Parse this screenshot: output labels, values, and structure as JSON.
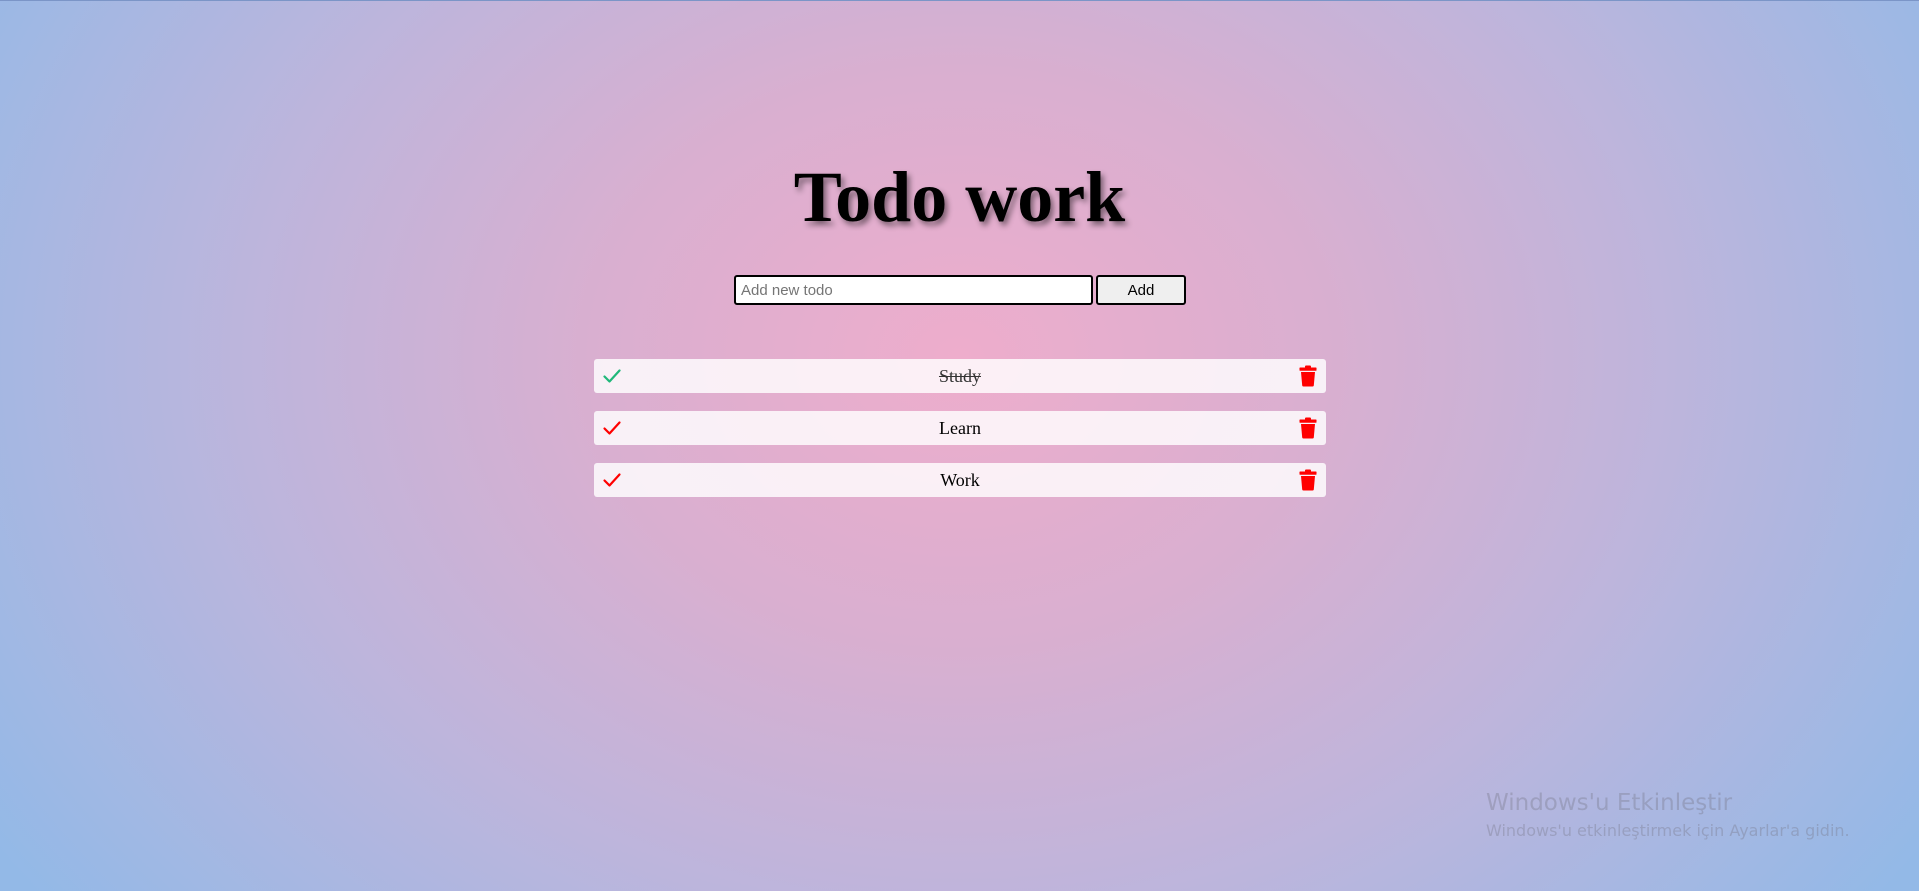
{
  "app": {
    "title": "Todo work"
  },
  "form": {
    "input_value": "",
    "input_placeholder": "Add new todo",
    "add_label": "Add"
  },
  "todos": [
    {
      "text": "Study",
      "completed": true,
      "check_icon": "check-icon",
      "check_color": "#20b87a",
      "delete_icon": "trash-icon",
      "delete_color": "#ff0000"
    },
    {
      "text": "Learn",
      "completed": false,
      "check_icon": "check-icon",
      "check_color": "#ff0000",
      "delete_icon": "trash-icon",
      "delete_color": "#ff0000"
    },
    {
      "text": "Work",
      "completed": false,
      "check_icon": "check-icon",
      "check_color": "#ff0000",
      "delete_icon": "trash-icon",
      "delete_color": "#ff0000"
    }
  ],
  "watermark": {
    "title": "Windows'u Etkinleştir",
    "subtitle": "Windows'u etkinleştirmek için Ayarlar'a gidin."
  },
  "colors": {
    "bg_center": "#eeadcc",
    "bg_edge": "#93b9e7",
    "done_check": "#20b87a",
    "pending_check": "#ff0000",
    "delete": "#ff0000"
  }
}
